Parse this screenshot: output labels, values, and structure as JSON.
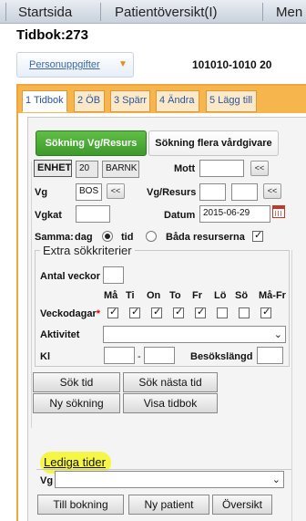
{
  "menu": {
    "items": [
      "Startsida",
      "Patientöversikt(I)",
      "Men"
    ]
  },
  "header": {
    "title": "Tidbok:273",
    "persondropdown_label": "Personuppgifter",
    "patient_id": "101010-1010 20"
  },
  "tabs": [
    {
      "label": "1 Tidbok",
      "active": true
    },
    {
      "label": "2 ÖB"
    },
    {
      "label": "3 Spärr"
    },
    {
      "label": "4 Ändra"
    },
    {
      "label": "5 Lägg till"
    }
  ],
  "search_tabs": {
    "vg_resurs": "Sökning Vg/Resurs",
    "flera": "Sökning flera vårdgivare"
  },
  "form": {
    "enhet_label": "ENHET",
    "enhet_num": "20",
    "enhet_name": "BARNK",
    "mott_label": "Mott",
    "mott_value": "",
    "vg_label": "Vg",
    "vg_value": "BOS",
    "vgresurs_label": "Vg/Resurs",
    "vgkat_label": "Vgkat",
    "datum_label": "Datum",
    "datum_value": "2015-06-29",
    "samma_label": "Samma:",
    "dag_label": "dag",
    "tid_label": "tid",
    "bada_label": "Båda resurserna",
    "picker_button": "<<"
  },
  "extra": {
    "legend": "Extra sökkriterier",
    "antal_veckor_label": "Antal veckor",
    "veckodagar_label": "Veckodagar",
    "required_mark": "*",
    "days": [
      "Må",
      "Ti",
      "On",
      "To",
      "Fr",
      "Lö",
      "Sö",
      "Må-Fr"
    ],
    "days_checked": [
      true,
      true,
      true,
      true,
      true,
      false,
      false,
      true
    ],
    "aktivitet_label": "Aktivitet",
    "kl_label": "Kl",
    "kl_sep": "-",
    "besokslangd_label": "Besökslängd"
  },
  "actions": {
    "sok_tid": "Sök tid",
    "sok_nasta_tid": "Sök nästa tid",
    "ny_sokning": "Ny sökning",
    "visa_tidbok": "Visa tidbok"
  },
  "lediga": {
    "title": "Lediga tider",
    "vg_label": "Vg",
    "till_bokning": "Till bokning",
    "ny_patient": "Ny patient",
    "oversikt": "Översikt"
  },
  "colors": {
    "accent_orange": "#f0a540",
    "green_button": "#4aa935",
    "highlight_yellow": "#f4f53b",
    "link_blue": "#3b68a8"
  }
}
